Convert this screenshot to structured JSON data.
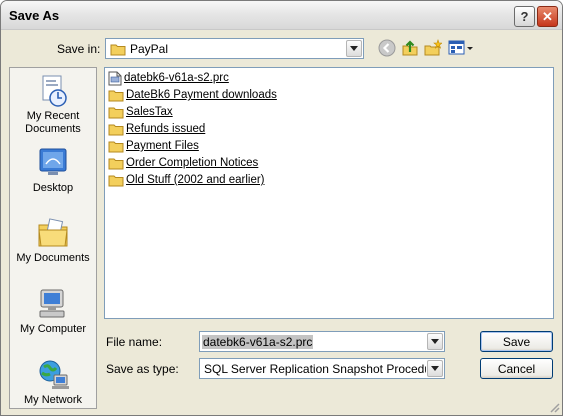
{
  "window": {
    "title": "Save As",
    "help_label": "?",
    "close_label": "✕"
  },
  "toolbar": {
    "save_in_label": "Save in:",
    "location": "PayPal",
    "icons": [
      "back-icon",
      "up-folder-icon",
      "new-folder-icon",
      "views-menu-icon"
    ]
  },
  "places": [
    {
      "label": "My Recent Documents",
      "icon": "recent-documents-icon"
    },
    {
      "label": "Desktop",
      "icon": "desktop-icon"
    },
    {
      "label": "My Documents",
      "icon": "my-documents-icon"
    },
    {
      "label": "My Computer",
      "icon": "my-computer-icon"
    },
    {
      "label": "My Network",
      "icon": "my-network-icon"
    }
  ],
  "files": [
    {
      "name": "datebk6-v61a-s2.prc",
      "icon": "file-icon"
    },
    {
      "name": "DateBk6 Payment downloads",
      "icon": "folder-icon"
    },
    {
      "name": "SalesTax",
      "icon": "folder-icon"
    },
    {
      "name": "Refunds issued",
      "icon": "folder-icon"
    },
    {
      "name": "Payment Files",
      "icon": "folder-icon"
    },
    {
      "name": "Order Completion Notices",
      "icon": "folder-icon"
    },
    {
      "name": "Old Stuff (2002 and earlier)",
      "icon": "folder-icon"
    }
  ],
  "form": {
    "file_name_label": "File name:",
    "file_name_value": "datebk6-v61a-s2.prc",
    "save_type_label": "Save as type:",
    "save_type_value": "SQL Server Replication Snapshot Procedure Sc"
  },
  "buttons": {
    "save": "Save",
    "cancel": "Cancel"
  },
  "colors": {
    "dialog_bg": "#ece9d8",
    "folder_yellow": "#f3cf5c",
    "field_border": "#7f9db9",
    "button_border": "#003c74",
    "close_red": "#c6361c"
  }
}
